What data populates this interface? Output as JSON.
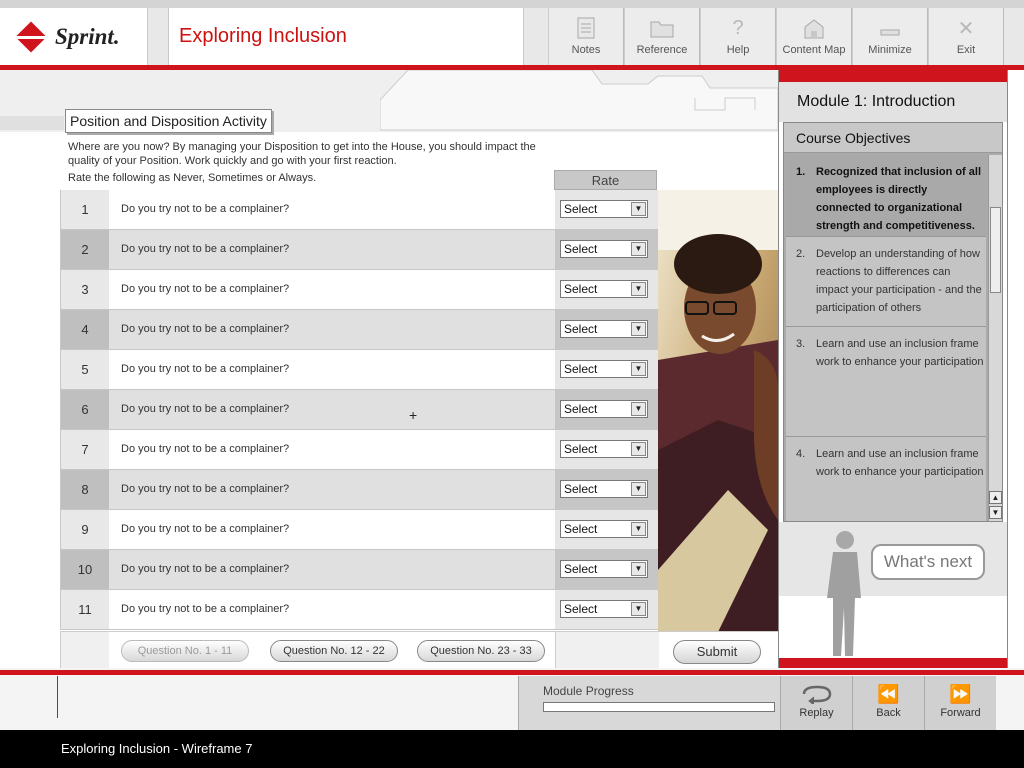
{
  "app": {
    "logo_text": "Sprint.",
    "title": "Exploring Inclusion"
  },
  "toolbar": [
    {
      "label": "Notes",
      "icon": "notes-icon"
    },
    {
      "label": "Reference",
      "icon": "folder-icon"
    },
    {
      "label": "Help",
      "icon": "help-icon"
    },
    {
      "label": "Content Map",
      "icon": "map-icon"
    },
    {
      "label": "Minimize",
      "icon": "minimize-icon"
    },
    {
      "label": "Exit",
      "icon": "close-icon"
    }
  ],
  "activity": {
    "title": "Position and Disposition Activity",
    "instructions": "Where are you now? By managing your Disposition to get into the House, you should impact the quality of your Position. Work quickly and go with your first reaction.",
    "rate_instruction": "Rate the following as Never, Sometimes or Always.",
    "rate_header": "Rate",
    "questions": [
      {
        "num": "1",
        "text": "Do you try not to be a complainer?",
        "value": "Select"
      },
      {
        "num": "2",
        "text": "Do you try not to be a complainer?",
        "value": "Select"
      },
      {
        "num": "3",
        "text": "Do you try not to be a complainer?",
        "value": "Select"
      },
      {
        "num": "4",
        "text": "Do you try not to be a complainer?",
        "value": "Select"
      },
      {
        "num": "5",
        "text": "Do you try not to be a complainer?",
        "value": "Select"
      },
      {
        "num": "6",
        "text": "Do you try not to be a complainer?",
        "value": "Select"
      },
      {
        "num": "7",
        "text": "Do you try not to be a complainer?",
        "value": "Select"
      },
      {
        "num": "8",
        "text": "Do you try not to be a complainer?",
        "value": "Select"
      },
      {
        "num": "9",
        "text": "Do you try not to be a complainer?",
        "value": "Select"
      },
      {
        "num": "10",
        "text": "Do you try not to be a complainer?",
        "value": "Select"
      },
      {
        "num": "11",
        "text": "Do you try not to be a complainer?",
        "value": "Select"
      }
    ],
    "page_buttons": [
      "Question No. 1 - 11",
      "Question No. 12 - 22",
      "Question No. 23 - 33"
    ],
    "submit_label": "Submit"
  },
  "panel": {
    "module_title": "Module 1: Introduction",
    "objectives_header": "Course Objectives",
    "objectives": [
      {
        "num": "1.",
        "text": "Recognized that inclusion of all employees is directly connected to organizational strength and competitiveness."
      },
      {
        "num": "2.",
        "text": "Develop an understanding of how reactions to differences can impact your participation - and the participation of others"
      },
      {
        "num": "3.",
        "text": "Learn and use an inclusion frame work to enhance your participation"
      },
      {
        "num": "4.",
        "text": "Learn and use an inclusion frame work to enhance your participation"
      }
    ],
    "whats_next": "What's next"
  },
  "footer": {
    "progress_label": "Module Progress",
    "progress_fraction": 0,
    "nav": [
      {
        "label": "Replay",
        "icon": "replay-icon"
      },
      {
        "label": "Back",
        "icon": "back-icon"
      },
      {
        "label": "Forward",
        "icon": "forward-icon"
      }
    ],
    "status": "Exploring Inclusion - Wireframe 7"
  },
  "colors": {
    "brand_red": "#d0141e",
    "panel_gray": "#c4c4c4"
  }
}
